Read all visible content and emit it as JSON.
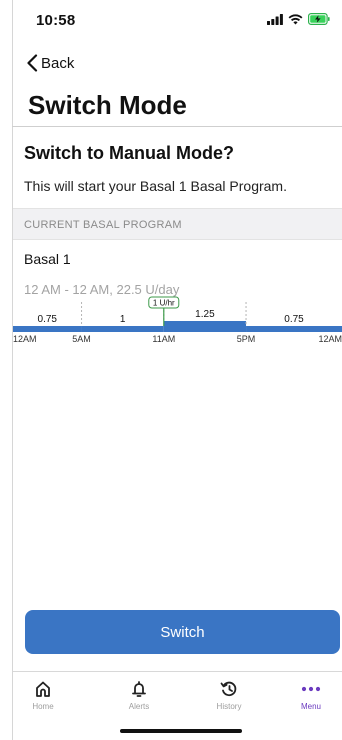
{
  "status": {
    "time": "10:58"
  },
  "nav": {
    "back_label": "Back"
  },
  "page": {
    "title": "Switch Mode"
  },
  "prompt": {
    "title": "Switch to Manual Mode?",
    "description": "This will start your Basal 1 Basal Program."
  },
  "program": {
    "header": "CURRENT BASAL PROGRAM",
    "name": "Basal 1",
    "summary": "12 AM - 12 AM, 22.5 U/day",
    "current_rate_label": "1 U/hr"
  },
  "chart_data": {
    "type": "bar",
    "segments": [
      {
        "start": "12AM",
        "end": "5AM",
        "rate": 0.75,
        "label": "0.75"
      },
      {
        "start": "5AM",
        "end": "11AM",
        "rate": 1,
        "label": "1"
      },
      {
        "start": "11AM",
        "end": "5PM",
        "rate": 1.25,
        "label": "1.25"
      },
      {
        "start": "5PM",
        "end": "12AM",
        "rate": 0.75,
        "label": "0.75"
      }
    ],
    "x_ticks": [
      "12AM",
      "5AM",
      "11AM",
      "5PM",
      "12AM"
    ],
    "current_marker": {
      "time": "11AM",
      "label": "1 U/hr"
    },
    "bar_color": "#3a75c4",
    "marker_color": "#3d9a4a"
  },
  "actions": {
    "switch_label": "Switch"
  },
  "tabs": [
    {
      "label": "Home",
      "icon": "home-icon",
      "active": false
    },
    {
      "label": "Alerts",
      "icon": "bell-icon",
      "active": false
    },
    {
      "label": "History",
      "icon": "history-icon",
      "active": false
    },
    {
      "label": "Menu",
      "icon": "more-icon",
      "active": true
    }
  ],
  "colors": {
    "accent": "#3a75c4",
    "menu_active": "#6b3bbf"
  }
}
